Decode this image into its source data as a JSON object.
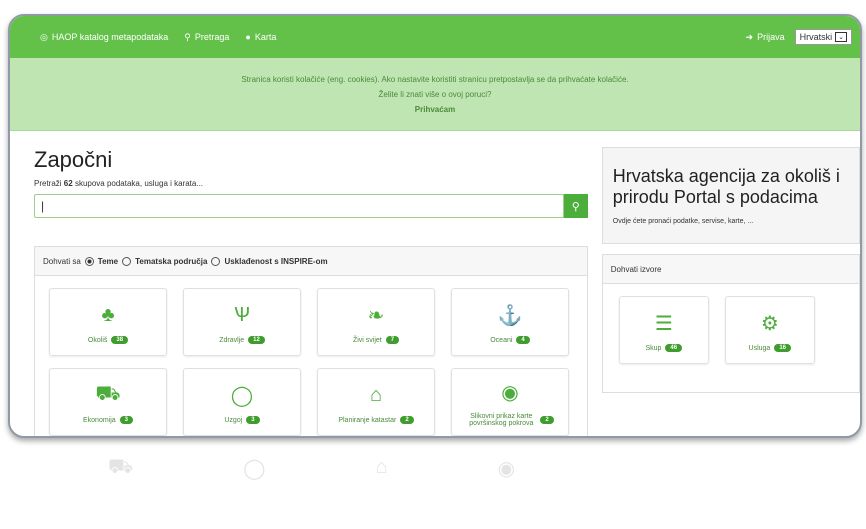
{
  "navbar": {
    "brand": "HAOP katalog metapodataka",
    "search": "Pretraga",
    "map": "Karta",
    "login": "Prijava",
    "language": "Hrvatski"
  },
  "cookie": {
    "line1": "Stranica koristi kolačiće (eng. cookies). Ako nastavite koristiti stranicu pretpostavlja se da prihvaćate kolačiće.",
    "line2": "Želite li znati više o ovoj poruci?",
    "accept": "Prihvaćam"
  },
  "left": {
    "title": "Započni",
    "subtitle_pre": "Pretraži",
    "subtitle_count": "62",
    "subtitle_post": "skupova podataka, usluga i karata...",
    "search_value": "|",
    "filter_prefix": "Dohvati sa",
    "filter_options": [
      "Teme",
      "Tematska područja",
      "Usklađenost s INSPIRE-om"
    ]
  },
  "categories": [
    {
      "label": "Okoliš",
      "count": "38",
      "icon": "tree-icon",
      "glyph": "♣"
    },
    {
      "label": "Zdravlje",
      "count": "12",
      "icon": "stethoscope-icon",
      "glyph": "Ѱ"
    },
    {
      "label": "Živi svijet",
      "count": "7",
      "icon": "leaf-icon",
      "glyph": "❧"
    },
    {
      "label": "Oceani",
      "count": "4",
      "icon": "anchor-icon",
      "glyph": "⚓"
    },
    {
      "label": "Ekonomija",
      "count": "3",
      "icon": "cart-icon",
      "glyph": "⛟"
    },
    {
      "label": "Uzgoj",
      "count": "3",
      "icon": "lemon-icon",
      "glyph": "◯"
    },
    {
      "label": "Planiranje katastar",
      "count": "2",
      "icon": "home-icon",
      "glyph": "⌂"
    },
    {
      "label": "Slikovni prikaz karte površinskog pokrova",
      "count": "2",
      "icon": "globe-icon",
      "glyph": "◉"
    }
  ],
  "right": {
    "title": "Hrvatska agencija za okoliš i prirodu Portal s podacima",
    "subtitle": "Ovdje ćete pronaći podatke, servise, karte, ...",
    "sources_title": "Dohvati izvore",
    "sources": [
      {
        "label": "Skup",
        "count": "46",
        "icon": "database-icon",
        "glyph": "☰"
      },
      {
        "label": "Usluga",
        "count": "16",
        "icon": "gear-icon",
        "glyph": "⚙"
      }
    ]
  },
  "colors": {
    "nav": "#63c14a",
    "cookie_bg": "#bfe6b2",
    "accent": "#4cae3a"
  }
}
